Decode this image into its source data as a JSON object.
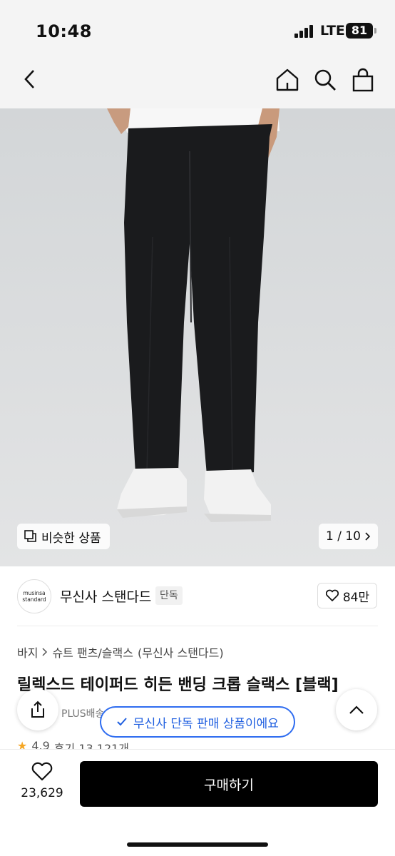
{
  "status_bar": {
    "time": "10:48",
    "network": "LTE",
    "battery": "81"
  },
  "nav": {
    "back_icon": "chevron-left-icon",
    "home_icon": "home-icon",
    "search_icon": "search-icon",
    "bag_icon": "shopping-bag-icon"
  },
  "gallery": {
    "similar_label": "비슷한 상품",
    "page_indicator": "1 / 10"
  },
  "brand": {
    "logo_line1": "musinsa",
    "logo_line2": "standard",
    "name": "무신사 스탠다드",
    "tag": "단독",
    "likes": "84만"
  },
  "breadcrumb": {
    "items": [
      "바지",
      "슈트 팬츠/슬랙스",
      "(무신사 스탠다드)"
    ]
  },
  "product": {
    "title": "릴렉스드 테이퍼드 히든 밴딩 크롭 슬랙스 [블랙]",
    "delivery": "PLUS배송",
    "rating": "4.9",
    "reviews": "후기 13,121개"
  },
  "banner": {
    "text": "무신사 단독 판매 상품이에요"
  },
  "bottom_bar": {
    "wish_count": "23,629",
    "buy_label": "구매하기"
  },
  "colors": {
    "accent_blue": "#2e6cf0",
    "buy_button": "#000000",
    "star": "#f5a623"
  }
}
